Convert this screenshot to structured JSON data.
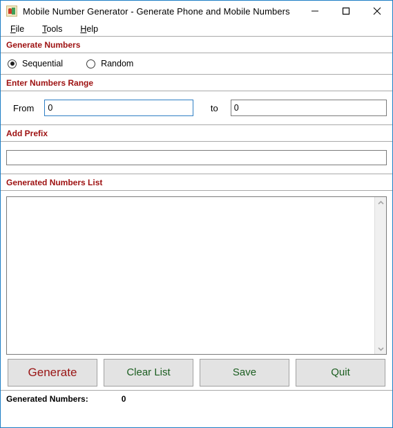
{
  "window": {
    "title": "Mobile Number Generator - Generate Phone and Mobile Numbers",
    "icon": "app-icon",
    "controls": {
      "minimize": "minimize-icon",
      "maximize": "maximize-icon",
      "close": "close-icon"
    },
    "border_color": "#1a7dc4"
  },
  "menubar": {
    "items": [
      {
        "label": "File",
        "accel": "F",
        "rest": "ile"
      },
      {
        "label": "Tools",
        "accel": "T",
        "rest": "ools"
      },
      {
        "label": "Help",
        "accel": "H",
        "rest": "elp"
      }
    ]
  },
  "sections": {
    "generate_numbers": {
      "header": "Generate Numbers",
      "options": [
        {
          "label": "Sequential",
          "selected": true
        },
        {
          "label": "Random",
          "selected": false
        }
      ]
    },
    "numbers_range": {
      "header": "Enter Numbers Range",
      "from_label": "From",
      "from_value": "0",
      "from_placeholder": "",
      "to_label": "to",
      "to_value": "0",
      "to_placeholder": ""
    },
    "add_prefix": {
      "header": "Add Prefix",
      "value": "",
      "placeholder": ""
    },
    "generated_list": {
      "header": "Generated Numbers List",
      "content": "",
      "scroll_up": "scroll-up-arrow",
      "scroll_down": "scroll-down-arrow"
    }
  },
  "buttons": {
    "generate": "Generate",
    "clear_list": "Clear List",
    "save": "Save",
    "quit": "Quit"
  },
  "statusbar": {
    "label": "Generated Numbers:",
    "value": "0"
  },
  "colors": {
    "section_header": "#9d1010",
    "primary_button_text": "#991414",
    "button_text": "#1b5e20",
    "window_border": "#1a7dc4",
    "focus_border": "#2e7ec4"
  }
}
